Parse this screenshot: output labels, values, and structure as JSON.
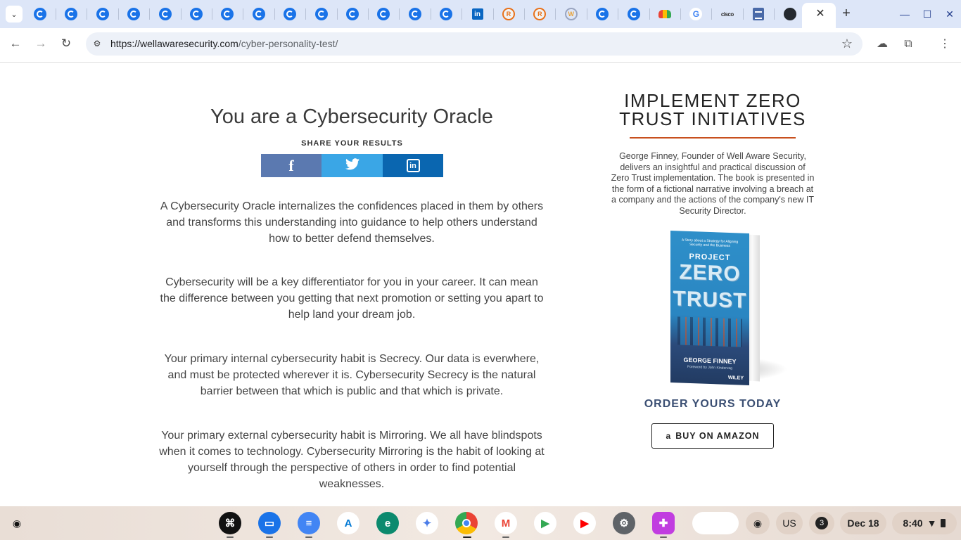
{
  "browser": {
    "tabs": [
      {
        "icon": "chrome-c-icon"
      },
      {
        "icon": "chrome-c-icon"
      },
      {
        "icon": "chrome-c-icon"
      },
      {
        "icon": "chrome-c-icon"
      },
      {
        "icon": "chrome-c-icon"
      },
      {
        "icon": "chrome-c-icon"
      },
      {
        "icon": "chrome-c-icon"
      },
      {
        "icon": "chrome-c-icon"
      },
      {
        "icon": "chrome-c-icon"
      },
      {
        "icon": "chrome-c-icon"
      },
      {
        "icon": "chrome-c-icon"
      },
      {
        "icon": "chrome-c-icon"
      },
      {
        "icon": "chrome-c-icon"
      },
      {
        "icon": "chrome-c-icon"
      },
      {
        "icon": "linkedin-icon",
        "text": "in"
      },
      {
        "icon": "r-badge-icon",
        "text": "R"
      },
      {
        "icon": "r-badge-icon",
        "text": "R"
      },
      {
        "icon": "w-logo-icon",
        "text": "W"
      },
      {
        "icon": "chrome-c-icon"
      },
      {
        "icon": "chrome-c-icon"
      },
      {
        "icon": "google-cloud-icon"
      },
      {
        "icon": "google-g-icon",
        "text": "G"
      },
      {
        "icon": "cisco-icon",
        "text": "cisco"
      },
      {
        "icon": "docs-icon"
      },
      {
        "icon": "github-icon"
      }
    ],
    "close_glyph": "✕",
    "new_tab_glyph": "+",
    "url_domain": "https://wellawaresecurity.com",
    "url_path": "/cyber-personality-test/"
  },
  "result": {
    "title": "You are a Cybersecurity Oracle",
    "share_label": "SHARE YOUR RESULTS",
    "share_buttons": {
      "facebook": "f",
      "twitter": "🐦",
      "linkedin": "in"
    },
    "paragraphs": [
      "A Cybersecurity Oracle internalizes the confidences placed in them by others and transforms this understanding into guidance to help others understand how to better defend themselves.",
      "Cybersecurity will be a key differentiator for you in your career. It can mean the difference between you getting that next promotion or setting you apart to help land your dream job.",
      "Your primary internal cybersecurity habit is Secrecy. Our data is everwhere, and must be protected wherever it is. Cybersecurity Secrecy is the natural barrier between that which is public and that which is private.",
      "Your primary external cybersecurity habit is Mirroring. We all have blindspots when it comes to technology. Cybersecurity Mirroring is the habit of looking at yourself through the perspective of others in order to find potential weaknesses."
    ]
  },
  "sidebar": {
    "heading": "IMPLEMENT ZERO TRUST INITIATIVES",
    "description": "George Finney, Founder of Well Aware Security, delivers an insightful and practical discussion of Zero Trust implementation. The book is presented in the form of a fictional narrative involving a breach at a company and the actions of the company's new IT Security Director.",
    "book": {
      "tagline": "A Story about a Strategy for Aligning Security and the Business",
      "project": "PROJECT",
      "zero": "ZERO",
      "trust": "TRUST",
      "author": "GEORGE FINNEY",
      "foreword": "Foreword by John Kindervag",
      "publisher": "WILEY"
    },
    "order_cta": "ORDER YOURS TODAY",
    "buy_button": "BUY ON AMAZON",
    "amazon_glyph": "a"
  },
  "shelf": {
    "apps": [
      "perplexity-icon",
      "files-icon",
      "docs-icon",
      "azure-icon",
      "edge-icon",
      "gemini-icon",
      "chrome-icon",
      "gmail-icon",
      "play-store-icon",
      "youtube-icon",
      "settings-icon",
      "screencast-icon"
    ],
    "ime": "US",
    "notifications": "3",
    "date": "Dec 18",
    "time": "8:40"
  }
}
